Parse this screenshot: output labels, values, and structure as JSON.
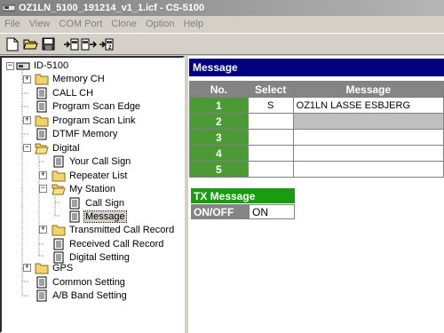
{
  "window": {
    "title": "OZ1LN_5100_191214_v1_1.icf - CS-5100"
  },
  "menu": [
    "File",
    "View",
    "COM Port",
    "Clone",
    "Option",
    "Help"
  ],
  "toolbar": {
    "icons": [
      "new-file-icon",
      "open-folder-icon",
      "save-icon",
      "read-from-radio-icon",
      "write-to-radio-icon",
      "clone-icon"
    ]
  },
  "tree": {
    "root": "ID-5100",
    "items": [
      {
        "label": "Memory CH"
      },
      {
        "label": "CALL CH"
      },
      {
        "label": "Program Scan Edge"
      },
      {
        "label": "Program Scan Link"
      },
      {
        "label": "DTMF Memory"
      },
      {
        "label": "Digital"
      },
      {
        "label": "Your Call Sign"
      },
      {
        "label": "Repeater List"
      },
      {
        "label": "My Station"
      },
      {
        "label": "Call Sign"
      },
      {
        "label": "Message"
      },
      {
        "label": "Transmitted Call Record"
      },
      {
        "label": "Received Call Record"
      },
      {
        "label": "Digital Setting"
      },
      {
        "label": "GPS"
      },
      {
        "label": "Common Setting"
      },
      {
        "label": "A/B Band Setting"
      }
    ]
  },
  "panel": {
    "title": "Message",
    "columns": [
      "No.",
      "Select",
      "Message"
    ],
    "rows": [
      {
        "no": "1",
        "select": "S",
        "message": "OZ1LN LASSE  ESBJERG"
      },
      {
        "no": "2",
        "select": "",
        "message": ""
      },
      {
        "no": "3",
        "select": "",
        "message": ""
      },
      {
        "no": "4",
        "select": "",
        "message": ""
      },
      {
        "no": "5",
        "select": "",
        "message": ""
      }
    ],
    "tx_message": {
      "title": "TX Message",
      "label": "ON/OFF",
      "value": "ON"
    }
  }
}
